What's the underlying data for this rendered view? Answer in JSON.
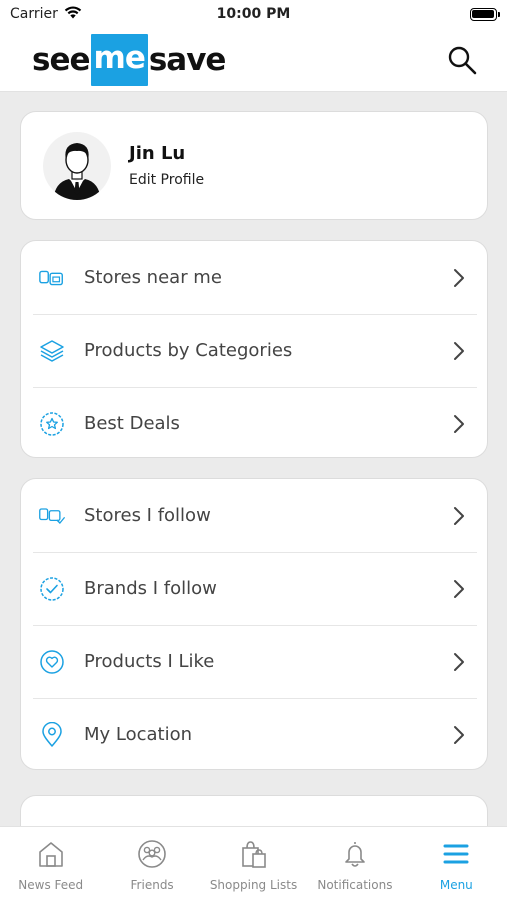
{
  "status_bar": {
    "carrier": "Carrier",
    "time": "10:00 PM"
  },
  "header": {
    "logo_part1": "see",
    "logo_part2": "me",
    "logo_part3": "save",
    "brand_color": "#1ba1e2"
  },
  "profile": {
    "name": "Jin Lu",
    "edit_label": "Edit Profile"
  },
  "menu_group_1": [
    {
      "label": "Stores near me",
      "icon": "store-icon"
    },
    {
      "label": "Products by Categories",
      "icon": "layers-icon"
    },
    {
      "label": "Best Deals",
      "icon": "star-badge-icon"
    }
  ],
  "menu_group_2": [
    {
      "label": "Stores I follow",
      "icon": "store-check-icon"
    },
    {
      "label": "Brands I follow",
      "icon": "check-badge-icon"
    },
    {
      "label": "Products I Like",
      "icon": "heart-badge-icon"
    },
    {
      "label": "My Location",
      "icon": "location-pin-icon"
    }
  ],
  "tab_bar": {
    "tabs": [
      {
        "label": "News Feed",
        "icon": "home-icon",
        "active": false
      },
      {
        "label": "Friends",
        "icon": "friends-icon",
        "active": false
      },
      {
        "label": "Shopping Lists",
        "icon": "shopping-bag-icon",
        "active": false
      },
      {
        "label": "Notifications",
        "icon": "bell-icon",
        "active": false
      },
      {
        "label": "Menu",
        "icon": "menu-icon",
        "active": true
      }
    ],
    "active_color": "#1ba1e2",
    "inactive_color": "#8a8a8a"
  }
}
